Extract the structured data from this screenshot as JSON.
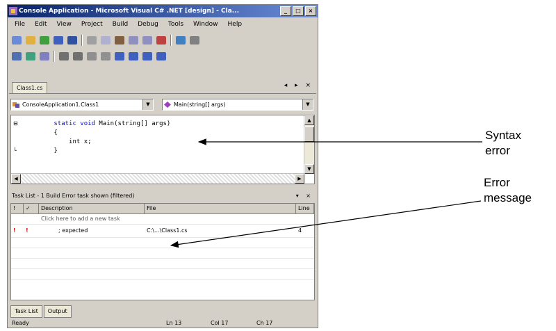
{
  "window": {
    "title": "Console Application - Microsoft Visual C# .NET [design] - Cla...",
    "buttons": [
      "_",
      "□",
      "×"
    ]
  },
  "menu": [
    "File",
    "Edit",
    "View",
    "Project",
    "Build",
    "Debug",
    "Tools",
    "Window",
    "Help"
  ],
  "panel": {
    "tab_label": "Class1.cs",
    "controls": "◂ ▸ ×"
  },
  "combos": {
    "left": "ConsoleApplication1.Class1",
    "right": "Main(string[] args)"
  },
  "code": {
    "line1_pre": "        ",
    "line1_kw": "static void",
    "line1_post": " Main(string[] args)",
    "line2": "        {",
    "line3": "            int x;",
    "line4": "        }"
  },
  "error_panel": {
    "title": "Task List - 1 Build Error task shown (filtered)",
    "controls": "▾ ×"
  },
  "error_table": {
    "columns": [
      "!",
      "✓",
      "Description",
      "File",
      "Line"
    ],
    "hint": "Click here to add a new task",
    "rows": [
      {
        "icon": "!",
        "desc": "; expected",
        "file": "C:\\...\\Class1.cs",
        "line": "4"
      }
    ]
  },
  "bottom_tabs": [
    "Task List",
    "Output"
  ],
  "status": {
    "left": "Ready",
    "ln": "Ln 13",
    "col": "Col 17",
    "ch": "Ch 17"
  },
  "annotations": {
    "syntax_error": [
      "Syntax",
      "error"
    ],
    "error_message": [
      "Error",
      "message"
    ]
  }
}
